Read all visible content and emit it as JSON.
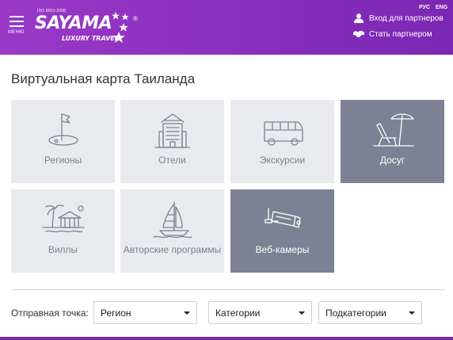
{
  "header": {
    "menu_label": "МЕНЮ",
    "logo": {
      "iso": "ISO 9001:2008",
      "brand": "SAYAMA",
      "tagline": "LUXURY TRAVEL",
      "registered": "®"
    },
    "languages": [
      "РУС",
      "ENG"
    ],
    "partner_login": "Вход для партнеров",
    "become_partner": "Стать партнером"
  },
  "page_title": "Виртуальная карта Таиланда",
  "tiles": [
    {
      "label": "Регионы",
      "icon": "golf-flag-icon",
      "active": false
    },
    {
      "label": "Отели",
      "icon": "hotel-building-icon",
      "active": false
    },
    {
      "label": "Экскурсии",
      "icon": "bus-icon",
      "active": false
    },
    {
      "label": "Досуг",
      "icon": "beach-chair-umbrella-icon",
      "active": true
    },
    {
      "label": "Виллы",
      "icon": "villa-pagoda-icon",
      "active": false
    },
    {
      "label": "Авторские программы",
      "icon": "sailboat-icon",
      "active": false
    },
    {
      "label": "Веб-камеры",
      "icon": "webcam-icon",
      "active": true
    }
  ],
  "filters": {
    "start_label": "Отправная точка:",
    "region": "Регион",
    "categories": "Категории",
    "subcategories": "Подкатегории"
  },
  "colors": {
    "header_purple": "#8b2fbf",
    "tile_light": "#e9eaee",
    "tile_active": "#7c8293"
  }
}
